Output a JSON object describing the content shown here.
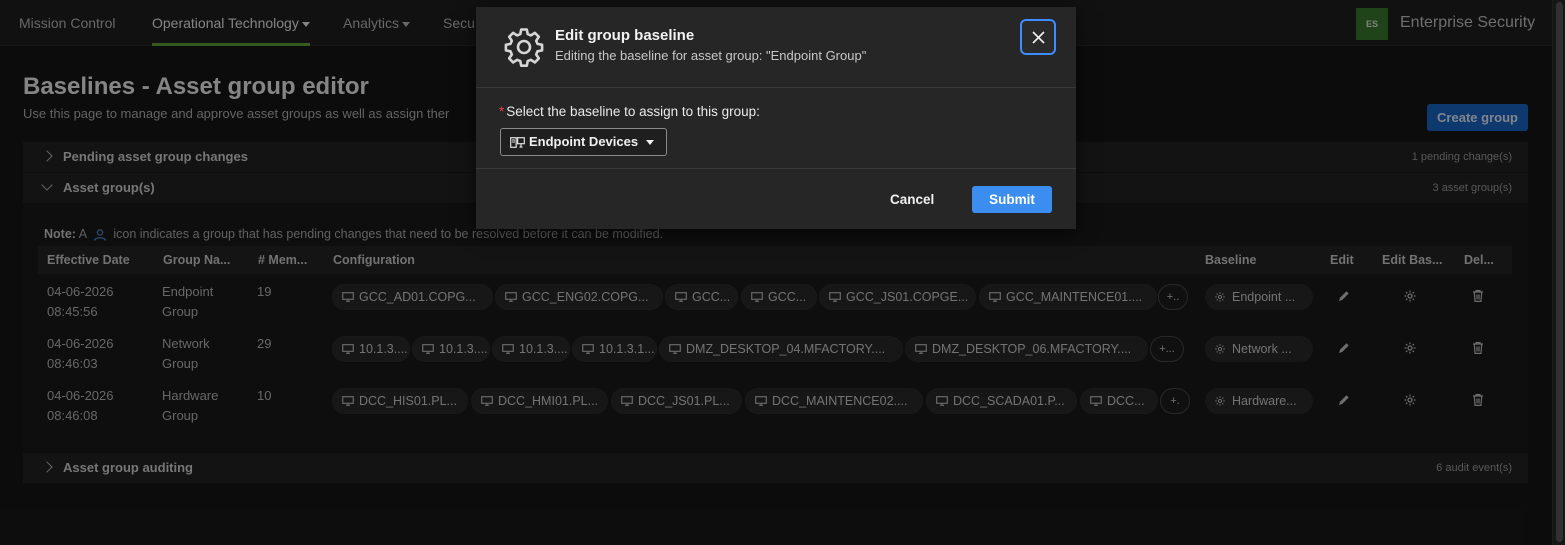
{
  "nav": {
    "items": [
      {
        "label": "Mission Control",
        "dropdown": false
      },
      {
        "label": "Operational Technology",
        "dropdown": true
      },
      {
        "label": "Analytics",
        "dropdown": true
      },
      {
        "label": "Secu",
        "dropdown": false
      }
    ],
    "active_index": 1,
    "app_badge": "ES",
    "app_name": "Enterprise Security",
    "accent_color": "#65a637"
  },
  "page": {
    "title": "Baselines - Asset group editor",
    "subtitle": "Use this page to manage and approve asset groups as well as assign ther",
    "create_button": "Create group"
  },
  "sections": {
    "pending": {
      "label": "Pending asset group changes",
      "count": "1 pending change(s)",
      "expanded": false
    },
    "groups": {
      "label": "Asset group(s)",
      "count": "3 asset group(s)",
      "expanded": true
    },
    "auditing": {
      "label": "Asset group auditing",
      "count": "6 audit event(s)",
      "expanded": false
    }
  },
  "note": {
    "prefix": "Note:",
    "before_icon": "A",
    "icon": "person-icon",
    "after_icon": "icon indicates a group that has pending changes that need to be resolved before it can be modified."
  },
  "table": {
    "headers": [
      "Effective Date",
      "Group Na...",
      "# Mem...",
      "Configuration",
      "Baseline",
      "Edit",
      "Edit Bas...",
      "Del..."
    ],
    "rows": [
      {
        "date": "04-06-2026",
        "time": "08:45:56",
        "group_line1": "Endpoint",
        "group_line2": "Group",
        "members": "19",
        "configs": [
          "GCC_AD01.COPG...",
          "GCC_ENG02.COPG...",
          "GCC...",
          "GCC...",
          "GCC_JS01.COPGE...",
          "GCC_MAINTENCE01...."
        ],
        "more": "+..",
        "baseline": "Endpoint ..."
      },
      {
        "date": "04-06-2026",
        "time": "08:46:03",
        "group_line1": "Network",
        "group_line2": "Group",
        "members": "29",
        "configs": [
          "10.1.3....",
          "10.1.3....",
          "10.1.3....",
          "10.1.3.1...",
          "DMZ_DESKTOP_04.MFACTORY....",
          "DMZ_DESKTOP_06.MFACTORY...."
        ],
        "more": "+...",
        "baseline": "Network ..."
      },
      {
        "date": "04-06-2026",
        "time": "08:46:08",
        "group_line1": "Hardware",
        "group_line2": "Group",
        "members": "10",
        "configs": [
          "DCC_HIS01.PL...",
          "DCC_HMI01.PL...",
          "DCC_JS01.PL...",
          "DCC_MAINTENCE02....",
          "DCC_SCADA01.P...",
          "DCC..."
        ],
        "more": "+.",
        "baseline": "Hardware..."
      }
    ]
  },
  "modal": {
    "title": "Edit group baseline",
    "subtitle": "Editing the baseline for asset group: \"Endpoint Group\"",
    "required_mark": "*",
    "field_label": "Select the baseline to assign to this group:",
    "selected_value": "Endpoint Devices",
    "cancel": "Cancel",
    "submit": "Submit",
    "submit_color": "#3b8ef0",
    "focus_ring_color": "#3f8cff"
  }
}
